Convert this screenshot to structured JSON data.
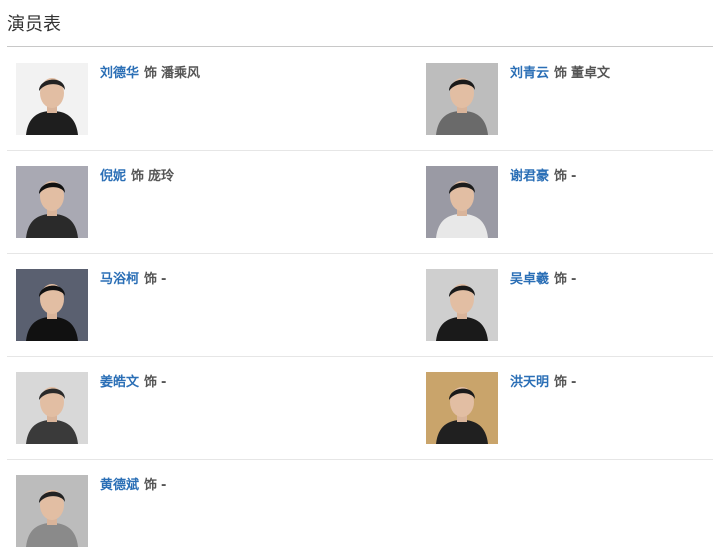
{
  "section": {
    "title": "演员表"
  },
  "cast": [
    {
      "actor": "刘德华",
      "connector": "饰",
      "role": "潘乘风",
      "photo": "actor-photo-icon",
      "bg": "#f2f2f2",
      "shirt": "#1e1e1e",
      "hair": "#222"
    },
    {
      "actor": "刘青云",
      "connector": "饰",
      "role": "董卓文",
      "photo": "actor-photo-icon",
      "bg": "#bdbdbd",
      "shirt": "#6a6a6a",
      "hair": "#1a1a1a"
    },
    {
      "actor": "倪妮",
      "connector": "饰",
      "role": "庞玲",
      "photo": "actor-photo-icon",
      "bg": "#a9a9b3",
      "shirt": "#2a2a2a",
      "hair": "#111"
    },
    {
      "actor": "谢君豪",
      "connector": "饰",
      "role": "-",
      "photo": "actor-photo-icon",
      "bg": "#9a9aa4",
      "shirt": "#e8e8e8",
      "hair": "#1c1c1c"
    },
    {
      "actor": "马浴柯",
      "connector": "饰",
      "role": "-",
      "photo": "actor-photo-icon",
      "bg": "#5a6070",
      "shirt": "#111",
      "hair": "#111"
    },
    {
      "actor": "吴卓羲",
      "connector": "饰",
      "role": "-",
      "photo": "actor-photo-icon",
      "bg": "#cfcfcf",
      "shirt": "#1a1a1a",
      "hair": "#1a1a1a"
    },
    {
      "actor": "姜皓文",
      "connector": "饰",
      "role": "-",
      "photo": "actor-photo-icon",
      "bg": "#d8d8d8",
      "shirt": "#3a3a3a",
      "hair": "#2a2a2a"
    },
    {
      "actor": "洪天明",
      "connector": "饰",
      "role": "-",
      "photo": "actor-photo-icon",
      "bg": "#c9a46b",
      "shirt": "#202020",
      "hair": "#1a1a1a"
    },
    {
      "actor": "黄德斌",
      "connector": "饰",
      "role": "-",
      "photo": "actor-photo-icon",
      "bg": "#bcbcbc",
      "shirt": "#8a8a8a",
      "hair": "#222"
    }
  ],
  "colors": {
    "link": "#2b6fb6",
    "text": "#555555",
    "divider": "#e6e6e6"
  }
}
